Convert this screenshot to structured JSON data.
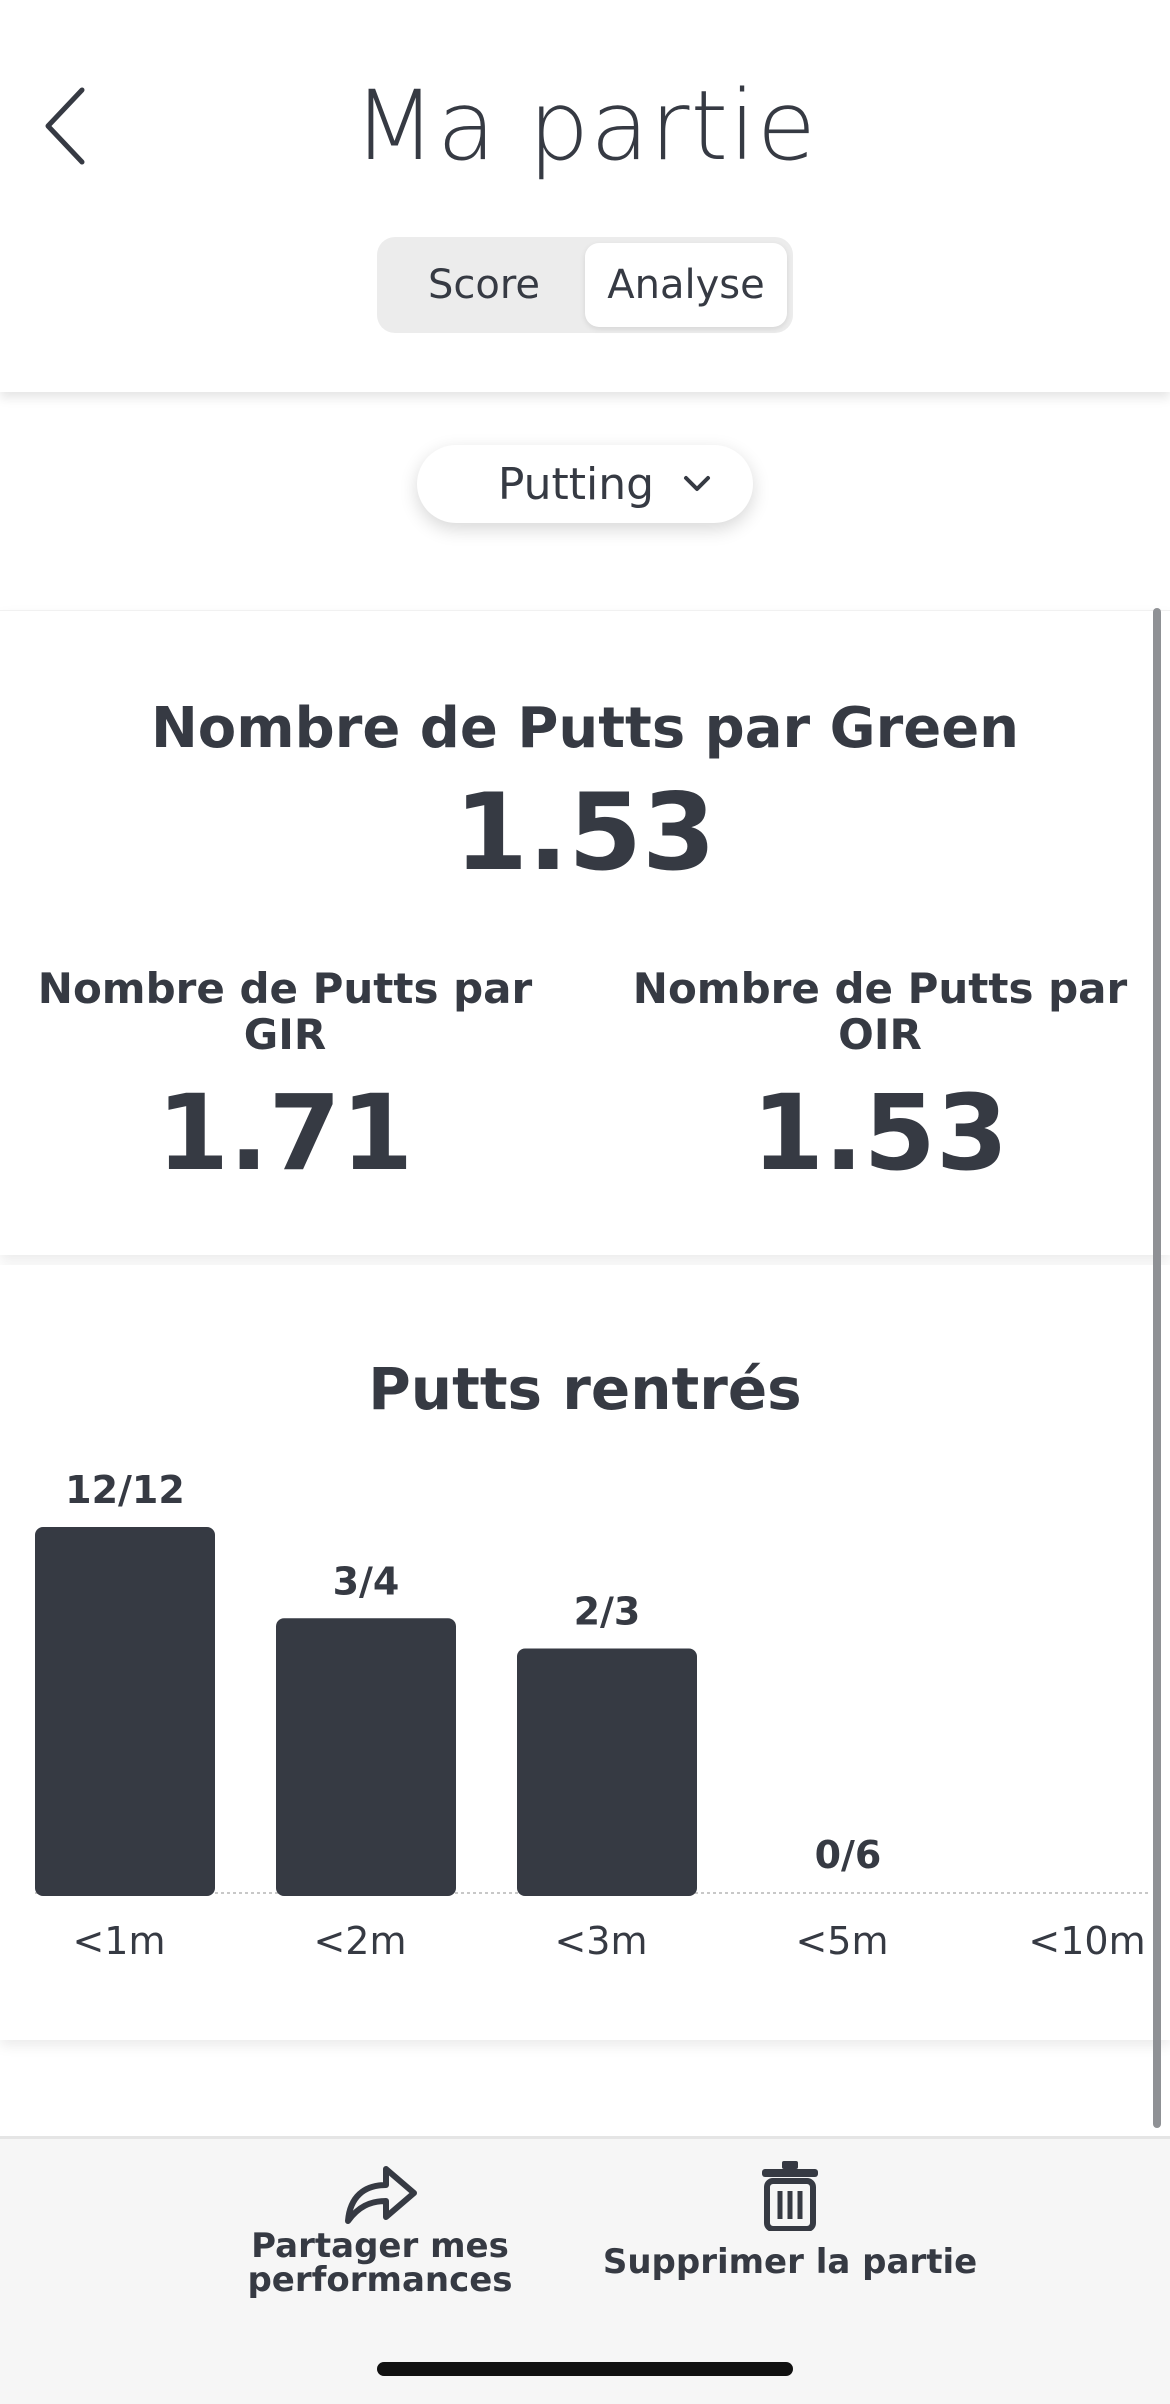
{
  "header": {
    "title": "Ma partie",
    "tabs": [
      {
        "label": "Score",
        "active": false
      },
      {
        "label": "Analyse",
        "active": true
      }
    ]
  },
  "filter": {
    "selected": "Putting"
  },
  "stats": {
    "main_label": "Nombre de Putts par Green",
    "main_value": "1.53",
    "gir_label_line1": "Nombre de Putts par",
    "gir_label_line2": "GIR",
    "gir_value": "1.71",
    "oir_label_line1": "Nombre de Putts par",
    "oir_label_line2": "OIR",
    "oir_value": "1.53"
  },
  "chart_data": {
    "type": "bar",
    "title": "Putts rentrés",
    "categories": [
      "<1m",
      "<2m",
      "<3m",
      "<5m",
      "<10m"
    ],
    "made": [
      12,
      3,
      2,
      0,
      null
    ],
    "attempts": [
      12,
      4,
      3,
      6,
      null
    ],
    "data_labels": [
      "12/12",
      "3/4",
      "2/3",
      "0/6",
      ""
    ],
    "values": [
      100,
      75,
      66.7,
      0,
      null
    ],
    "ylim": [
      0,
      100
    ],
    "bar_color": "#363a43"
  },
  "actions": {
    "share_line1": "Partager mes",
    "share_line2": "performances",
    "delete_label": "Supprimer la partie"
  },
  "colors": {
    "text": "#363a43",
    "bottombar": "#f6f6f6",
    "segment_bg": "#ececec"
  }
}
